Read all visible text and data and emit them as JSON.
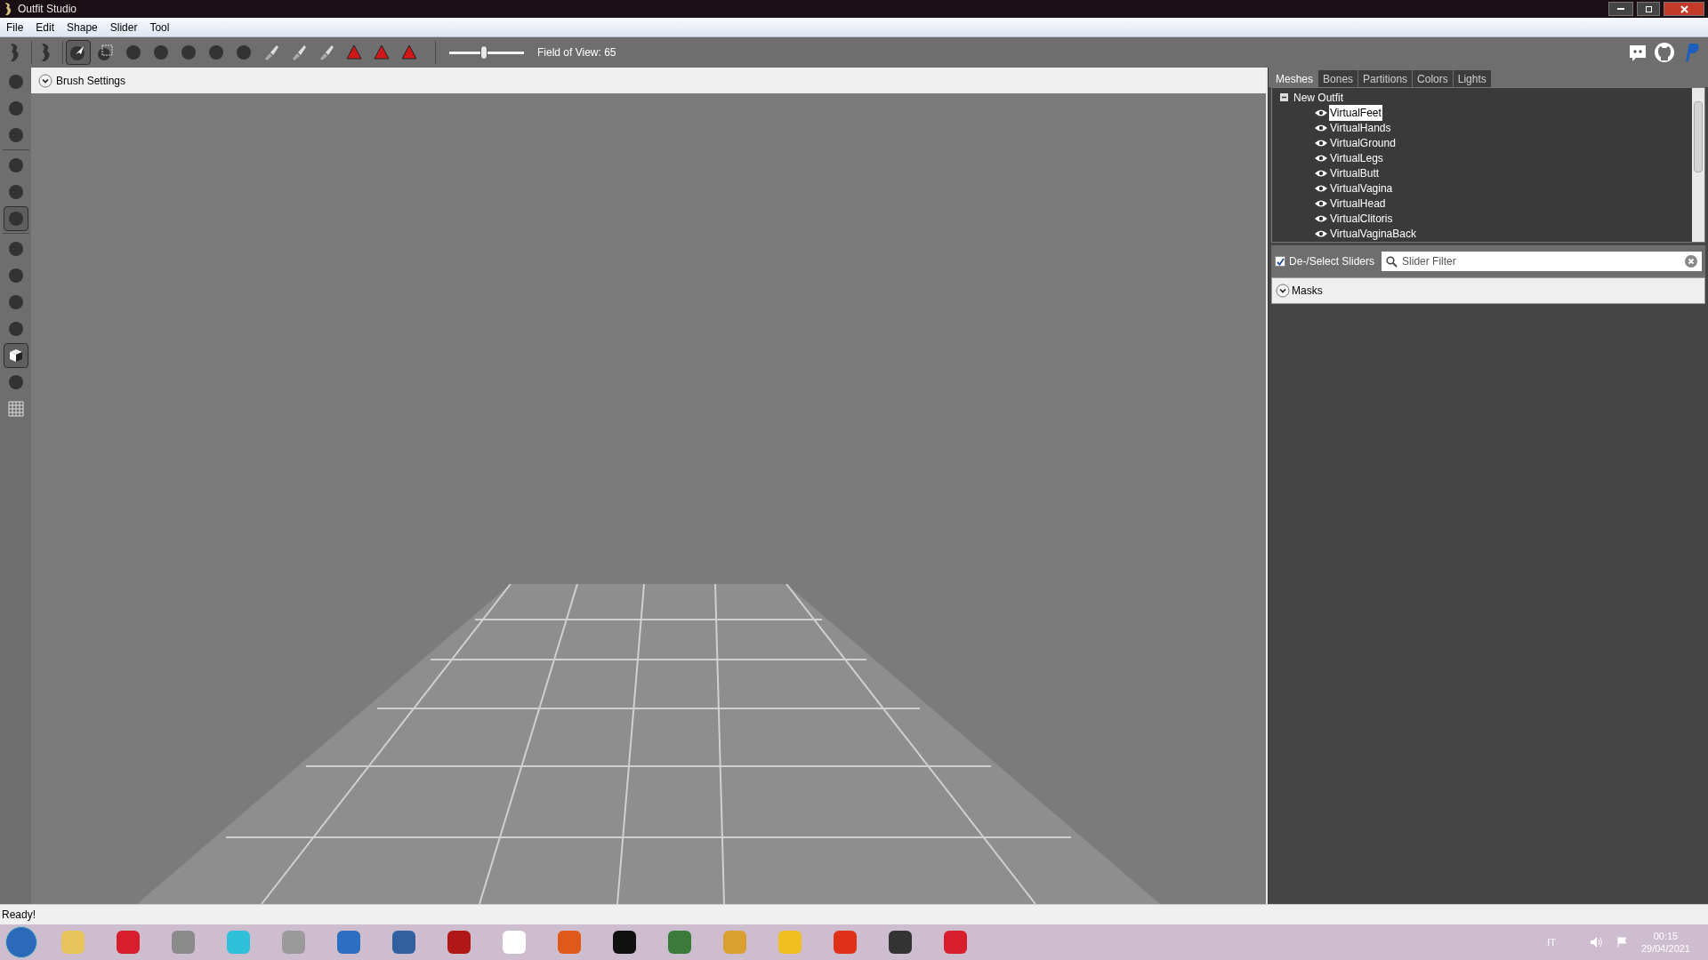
{
  "window": {
    "title": "Outfit Studio"
  },
  "menu": [
    "File",
    "Edit",
    "Shape",
    "Slider",
    "Tool"
  ],
  "toolbar": {
    "tools": [
      {
        "kind": "project",
        "selected": false
      },
      {
        "kind": "project",
        "selected": false
      },
      {
        "kind": "select",
        "selected": true
      },
      {
        "kind": "mask",
        "selected": false
      },
      {
        "kind": "brush",
        "selected": false
      },
      {
        "kind": "brush",
        "selected": false
      },
      {
        "kind": "brush",
        "selected": false
      },
      {
        "kind": "brush",
        "selected": false
      },
      {
        "kind": "brush",
        "selected": false
      },
      {
        "kind": "paint",
        "selected": false
      },
      {
        "kind": "paint",
        "selected": false
      },
      {
        "kind": "paint",
        "selected": false
      },
      {
        "kind": "vertex",
        "selected": false
      },
      {
        "kind": "vertex",
        "selected": false
      },
      {
        "kind": "vertex",
        "selected": false
      }
    ],
    "fov_slider": {
      "level": 0.47
    },
    "fov_label": "Field of View: 65"
  },
  "side_tools": [
    {
      "kind": "brush",
      "selected": false
    },
    {
      "kind": "brush",
      "selected": false
    },
    {
      "kind": "brush",
      "selected": false
    },
    {
      "kind": "brush",
      "selected": false
    },
    {
      "kind": "brush",
      "selected": false
    },
    {
      "kind": "brush",
      "selected": true
    },
    {
      "kind": "brush",
      "selected": false
    },
    {
      "kind": "brush",
      "selected": false
    },
    {
      "kind": "brush",
      "selected": false
    },
    {
      "kind": "brush",
      "selected": false
    },
    {
      "kind": "cube",
      "selected": true
    },
    {
      "kind": "brush",
      "selected": false
    },
    {
      "kind": "grid",
      "selected": false
    }
  ],
  "brush_settings": {
    "label": "Brush Settings",
    "expanded": false
  },
  "tabs": [
    {
      "label": "Meshes",
      "selected": true
    },
    {
      "label": "Bones",
      "selected": false
    },
    {
      "label": "Partitions",
      "selected": false
    },
    {
      "label": "Colors",
      "selected": false
    },
    {
      "label": "Lights",
      "selected": false
    }
  ],
  "tree": {
    "label": "New Outfit",
    "expanded": true,
    "children": [
      {
        "label": "VirtualFeet",
        "selected": true
      },
      {
        "label": "VirtualHands",
        "selected": false
      },
      {
        "label": "VirtualGround",
        "selected": false
      },
      {
        "label": "VirtualLegs",
        "selected": false
      },
      {
        "label": "VirtualButt",
        "selected": false
      },
      {
        "label": "VirtualVagina",
        "selected": false
      },
      {
        "label": "VirtualHead",
        "selected": false
      },
      {
        "label": "VirtualClitoris",
        "selected": false
      },
      {
        "label": "VirtualVaginaBack",
        "selected": false
      }
    ]
  },
  "slider_select": {
    "label": "De-/Select Sliders",
    "checked": true
  },
  "slider_filter": {
    "placeholder": "Slider Filter"
  },
  "masks": {
    "label": "Masks",
    "expanded": false
  },
  "status_bar": "Ready!",
  "taskbar": {
    "apps": [
      {
        "color": "#e8c25a"
      },
      {
        "color": "#d81e2c"
      },
      {
        "color": "#8a8a8a"
      },
      {
        "color": "#2ec0d8"
      },
      {
        "color": "#9a9a9a"
      },
      {
        "color": "#2c6fc0"
      },
      {
        "color": "#3060a0"
      },
      {
        "color": "#b01818"
      },
      {
        "color": "#ffffff"
      },
      {
        "color": "#e0581a"
      },
      {
        "color": "#111111"
      },
      {
        "color": "#3a7a3a"
      },
      {
        "color": "#d8a030"
      },
      {
        "color": "#f0c020"
      },
      {
        "color": "#e03018"
      },
      {
        "color": "#333333"
      },
      {
        "color": "#d81e2c"
      }
    ],
    "language": "IT",
    "time": "00:15",
    "date": "29/04/2021"
  }
}
